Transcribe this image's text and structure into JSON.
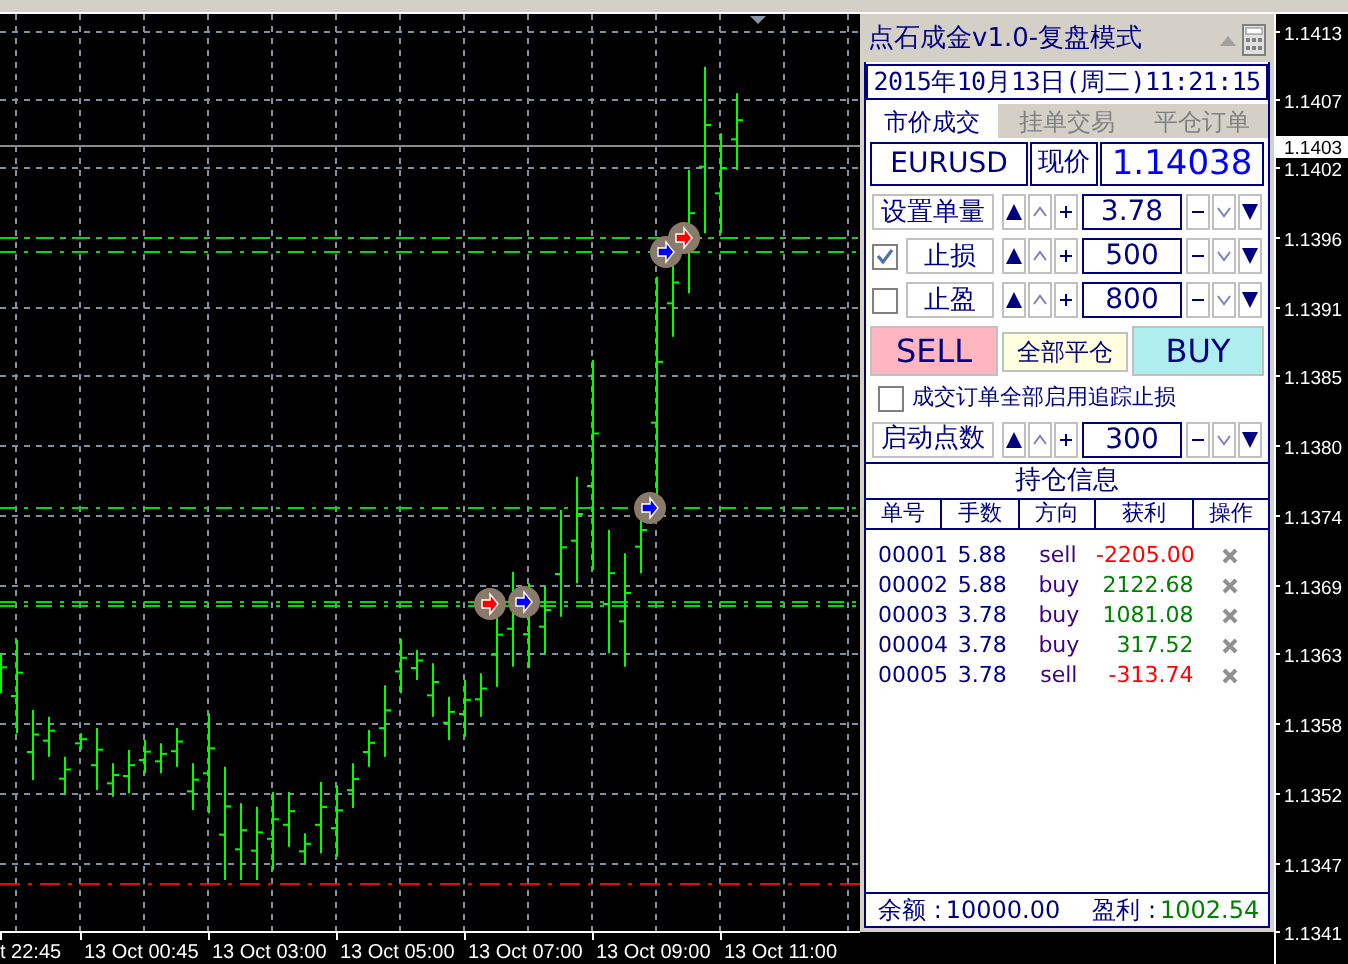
{
  "chart": {
    "price_labels": [
      "1.1413",
      "1.1407",
      "1.1402",
      "1.1396",
      "1.1391",
      "1.1385",
      "1.1380",
      "1.1374",
      "1.1369",
      "1.1363",
      "1.1358",
      "1.1352",
      "1.1347",
      "1.1341"
    ],
    "current_price": "1.1403",
    "time_labels": [
      "t 22:45",
      "13 Oct 00:45",
      "13 Oct 03:00",
      "13 Oct 05:00",
      "13 Oct 07:00",
      "13 Oct 09:00",
      "13 Oct 11:00"
    ]
  },
  "panel": {
    "title": "点石成金v1.0-复盘模式",
    "datetime": "2015年10月13日(周二)11:21:15",
    "tabs": [
      {
        "label": "市价成交",
        "selected": true
      },
      {
        "label": "挂单交易",
        "selected": false
      },
      {
        "label": "平仓订单",
        "selected": false
      }
    ],
    "symbol": "EURUSD",
    "price_label": "现价",
    "price": "1.14038",
    "steppers": [
      {
        "kind": "label",
        "label": "设置单量",
        "value": "3.78"
      },
      {
        "kind": "checkbox",
        "label": "止损",
        "checked": true,
        "value": "500"
      },
      {
        "kind": "checkbox",
        "label": "止盈",
        "checked": false,
        "value": "800"
      }
    ],
    "sell_button": "SELL",
    "close_all_button": "全部平仓",
    "buy_button": "BUY",
    "trailing": {
      "label": "成交订单全部启用追踪止损",
      "checked": false
    },
    "start_stepper": {
      "kind": "label",
      "label": "启动点数",
      "value": "300"
    },
    "positions": {
      "title": "持仓信息",
      "columns": [
        "单号",
        "手数",
        "方向",
        "获利",
        "操作"
      ],
      "rows": [
        {
          "ticket": "00001",
          "lots": "5.88",
          "direction": "sell",
          "profit": "-2205.00",
          "color": "#ff0000"
        },
        {
          "ticket": "00002",
          "lots": "5.88",
          "direction": "buy",
          "profit": "2122.68",
          "color": "#008000"
        },
        {
          "ticket": "00003",
          "lots": "3.78",
          "direction": "buy",
          "profit": "1081.08",
          "color": "#008000"
        },
        {
          "ticket": "00004",
          "lots": "3.78",
          "direction": "buy",
          "profit": "317.52",
          "color": "#008000"
        },
        {
          "ticket": "00005",
          "lots": "3.78",
          "direction": "sell",
          "profit": "-313.74",
          "color": "#ff0000"
        }
      ]
    },
    "footer": {
      "balance_label": "余额 :",
      "balance": "10000.00",
      "profit_label": "盈利 :",
      "profit": "1002.54"
    }
  }
}
